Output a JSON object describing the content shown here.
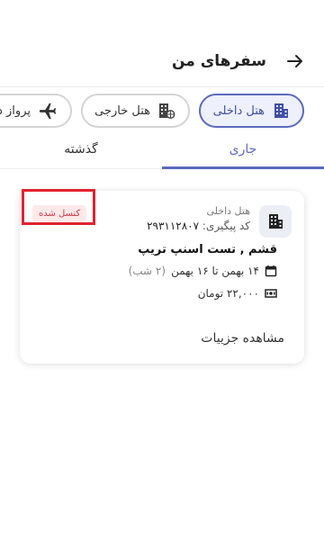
{
  "header": {
    "title": "سفرهای من"
  },
  "categories": {
    "domestic_hotel": "هتل داخلی",
    "foreign_hotel": "هتل خارجی",
    "flight": "پرواز دا"
  },
  "tabs": {
    "current": "جاری",
    "past": "گذشته"
  },
  "booking": {
    "type_label": "هتل داخلی",
    "tracking_label": "کد پیگیری:",
    "tracking_code": "۲۹۳۱۱۲۸۰۷",
    "status": "کنسل شده",
    "hotel_name": "قشم , تست اسنپ تریپ",
    "dates": "۱۴ بهمن تا ۱۶ بهمن",
    "nights": "(۲ شب)",
    "price": "۲۲,۰۰۰ تومان",
    "details_link": "مشاهده جزییات"
  },
  "colors": {
    "accent": "#5b6bc0",
    "status_red": "#d23b44",
    "highlight_red": "#e0232e"
  },
  "icons": {
    "back": "arrow-right-icon",
    "hotel": "building-icon",
    "foreign_hotel": "building-globe-icon",
    "flight": "airplane-icon",
    "calendar": "calendar-icon",
    "price": "cash-icon"
  }
}
